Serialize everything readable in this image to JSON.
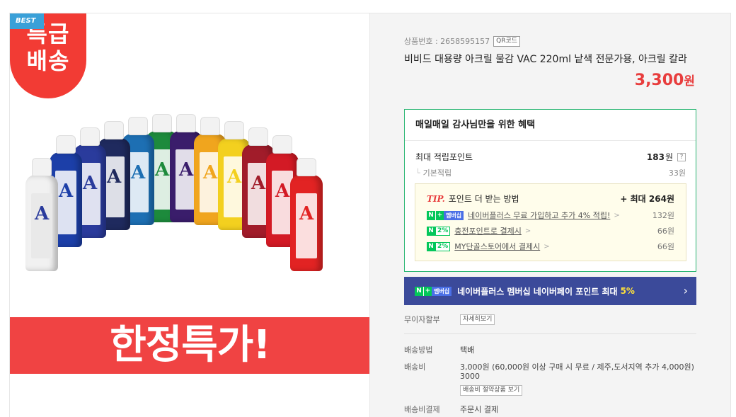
{
  "badge": {
    "best": "BEST",
    "line1": "특급",
    "line2": "배송"
  },
  "image": {
    "promo_text": "한정특가!",
    "bottle_letter": "A",
    "bottle_colors": [
      "#f1f1f1",
      "#1c3fa8",
      "#2a3b9c",
      "#1f2a5e",
      "#1d6fb3",
      "#1d8a3c",
      "#3a1d6b",
      "#f0a51e",
      "#f3d01f",
      "#a11c2a",
      "#d31a25",
      "#e22323"
    ]
  },
  "product": {
    "id_label": "상품번호 : 2658595157",
    "qr_label": "QR코드",
    "title": "비비드 대용량 아크릴 물감 VAC 220ml 낱색 전문가용, 아크릴 칼라",
    "price": "3,300",
    "price_unit": "원"
  },
  "benefit": {
    "heading": "매일매일 감사님만을 위한 혜택",
    "max_label": "최대 적립포인트",
    "max_value": "183",
    "max_unit": "원",
    "help": "?",
    "base_label": "기본적립",
    "base_value": "33원",
    "tip": {
      "tip_label": "TIP.",
      "heading": "포인트 더 받는 방법",
      "max": "+ 최대 264원",
      "rows": [
        {
          "badge_extra": "멤버십",
          "text": "네이버플러스 무료 가입하고 추가 4% 적립!",
          "amount": "132원"
        },
        {
          "badge_extra": "2%",
          "text": "충전포인트로 결제시",
          "amount": "66원"
        },
        {
          "badge_extra": "2%",
          "text": "MY단골스토어에서 결제시",
          "amount": "66원"
        }
      ]
    }
  },
  "banner": {
    "badge_extra": "멤버십",
    "text": "네이버플러스 멤버십 네이버페이 포인트 최대",
    "highlight": "5%"
  },
  "details": {
    "installment_label": "무이자할부",
    "installment_btn": "자세히보기",
    "shipping_method_label": "배송방법",
    "shipping_method_value": "택배",
    "shipping_fee_label": "배송비",
    "shipping_fee_value": "3,000원 (60,000원 이상 구매 시 무료 / 제주,도서지역 추가 4,000원)",
    "shipping_fee_sub": "3000",
    "shipping_fee_btn": "배송비 절약상품 보기",
    "fee_payment_label": "배송비결제",
    "fee_payment_value": "주문시 결제"
  }
}
